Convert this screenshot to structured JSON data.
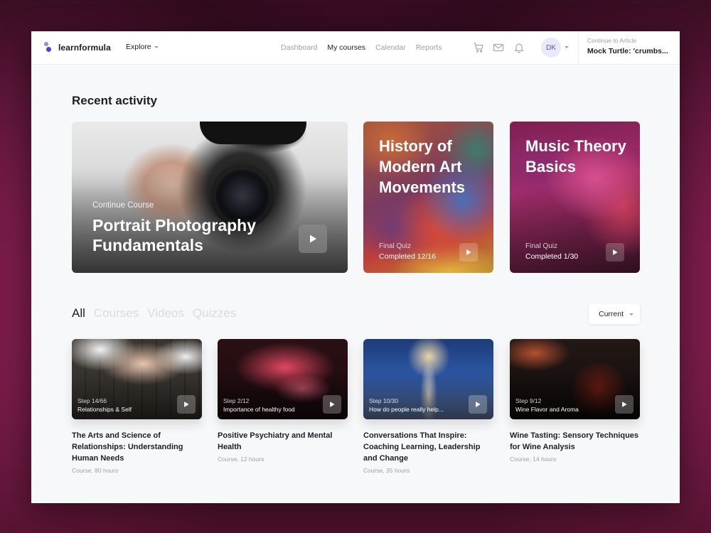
{
  "brand": {
    "name": "learnformula"
  },
  "header": {
    "explore_label": "Explore",
    "nav": [
      "Dashboard",
      "My courses",
      "Calendar",
      "Reports"
    ],
    "active_nav": "My courses",
    "avatar_initials": "DK",
    "continue_label": "Continue to Article",
    "continue_title": "Mock Turtle: 'crumbs..."
  },
  "recent": {
    "title": "Recent activity",
    "featured": {
      "label": "Continue Course",
      "title": "Portrait Photography Fundamentals"
    },
    "cards": [
      {
        "title": "History of Modern Art Movements",
        "sub1": "Final Quiz",
        "sub2": "Completed 12/16"
      },
      {
        "title": "Music Theory Basics",
        "sub1": "Final Quiz",
        "sub2": "Completed 1/30"
      }
    ]
  },
  "filters": {
    "tabs": [
      "All",
      "Courses",
      "Videos",
      "Quizzes"
    ],
    "active": "All",
    "sort_label": "Current"
  },
  "courses": [
    {
      "step": "Step 14/66",
      "lesson": "Relationships & Self",
      "title": "The Arts and Science of Relationships: Understanding Human Needs",
      "meta": "Course, 80 hours"
    },
    {
      "step": "Step 2/12",
      "lesson": "Importance of healthy food",
      "title": "Positive Psychiatry and Mental Health",
      "meta": "Course, 12 hours"
    },
    {
      "step": "Step 10/30",
      "lesson": "How do people really help...",
      "title": "Conversations That Inspire: Coaching Learning, Leadership and Change",
      "meta": "Course, 35 hours"
    },
    {
      "step": "Step 9/12",
      "lesson": "Wine Flavor and Aroma",
      "title": "Wine Tasting: Sensory Techniques for Wine Analysis",
      "meta": "Course, 14 hours"
    }
  ],
  "colors": {
    "accent": "#4b3ee0",
    "text": "#1d1f27",
    "muted": "#9aa0ab"
  }
}
